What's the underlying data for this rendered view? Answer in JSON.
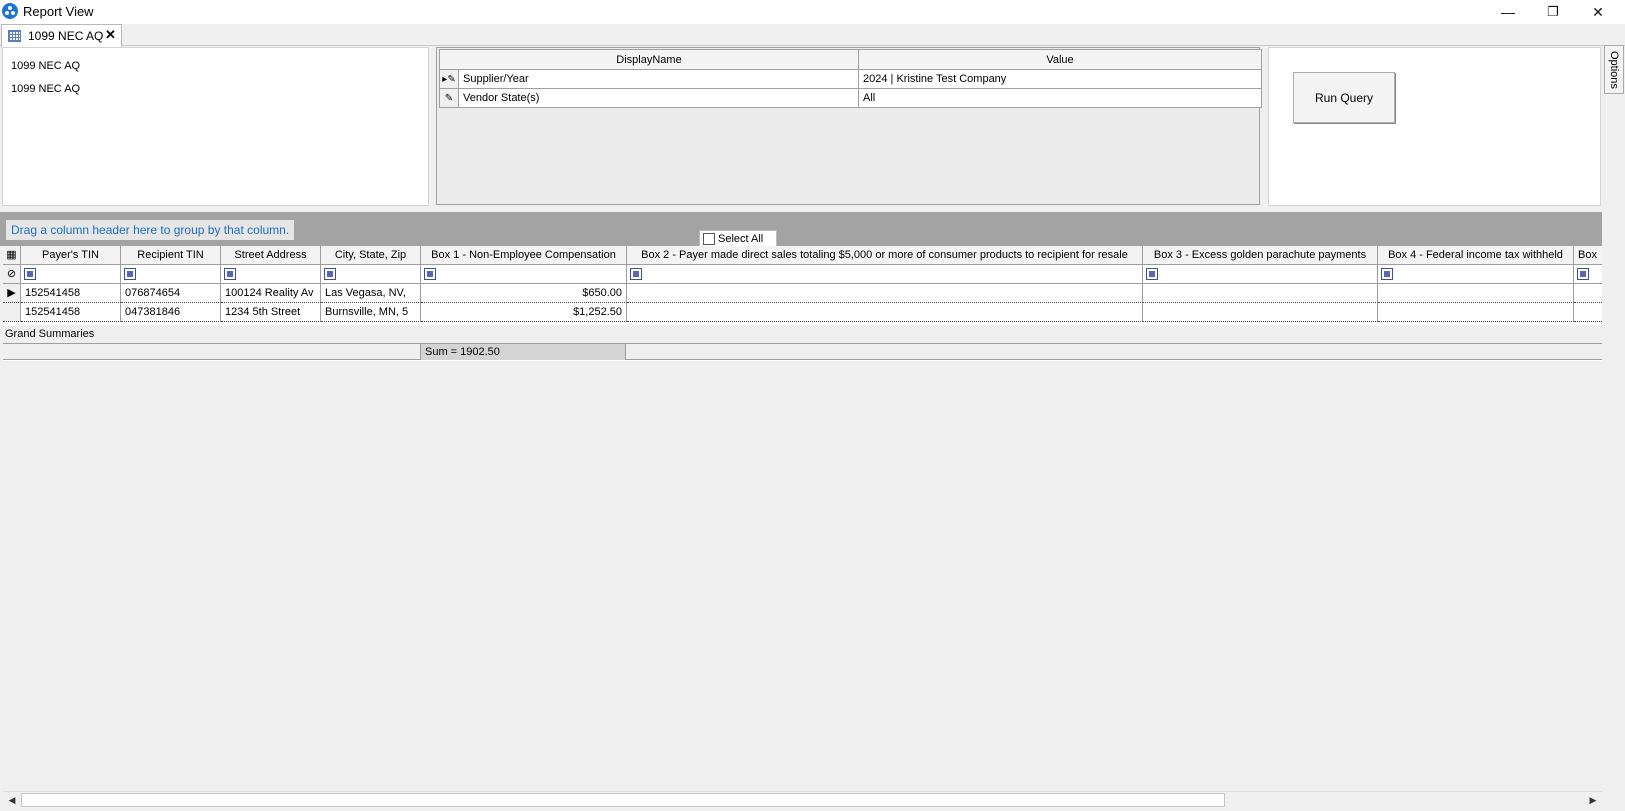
{
  "window": {
    "title": "Report View",
    "controls": {
      "minimize": "—",
      "restore": "❐",
      "close": "✕"
    }
  },
  "tab": {
    "label": "1099 NEC AQ",
    "close": "✕",
    "icon": "grid-icon"
  },
  "report_info": {
    "name": "1099 NEC AQ",
    "description": "1099 NEC AQ"
  },
  "parameters": {
    "headers": {
      "display_name": "DisplayName",
      "value": "Value"
    },
    "rows": [
      {
        "indicator": "▸✎",
        "name": "Supplier/Year",
        "value": "2024 | Kristine Test Company"
      },
      {
        "indicator": "✎",
        "name": "Vendor State(s)",
        "value": "All"
      }
    ]
  },
  "run_query": {
    "label": "Run Query"
  },
  "options_tab": {
    "label": "Options"
  },
  "group_panel": {
    "hint": "Drag a column header here to group by that column."
  },
  "select_all": {
    "label": "Select All",
    "checked": false
  },
  "grid": {
    "columns": [
      "Payer's TIN",
      "Recipient TIN",
      "Street Address",
      "City, State, Zip",
      "Box 1 - Non-Employee Compensation",
      "Box 2 - Payer made direct sales totaling $5,000 or more of consumer products to recipient for resale",
      "Box 3 - Excess golden parachute payments",
      "Box 4 - Federal income tax withheld",
      "Box"
    ],
    "rows": [
      {
        "payer_tin": "152541458",
        "recipient_tin": "076874654",
        "street": "100124 Reality Av",
        "city": "Las Vegasa, NV,",
        "box1": "$650.00",
        "current": true
      },
      {
        "payer_tin": "152541458",
        "recipient_tin": "047381846",
        "street": "1234 5th Street",
        "city": "Burnsville, MN, 5",
        "box1": "$1,252.50",
        "current": false
      }
    ]
  },
  "summaries": {
    "label": "Grand Summaries",
    "box1_sum": "Sum = 1902.50"
  },
  "scrollbar": {
    "left_arrow": "◀",
    "right_arrow": "▶"
  }
}
